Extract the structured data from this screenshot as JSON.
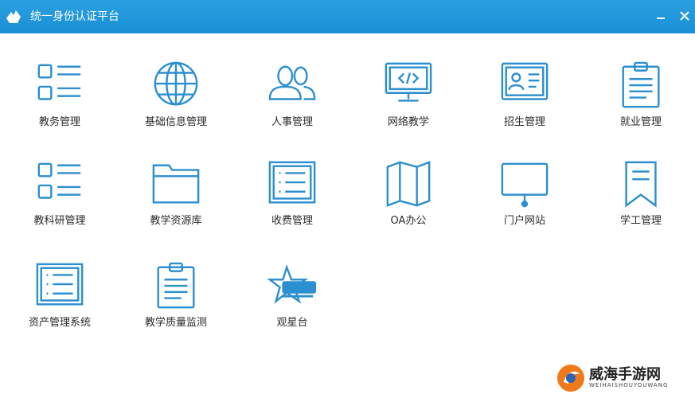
{
  "window": {
    "title": "统一身份认证平台",
    "accent": "#1f95da",
    "icon_color": "#2c8fd0"
  },
  "tiles": [
    {
      "label": "教务管理",
      "icon": "list-icon"
    },
    {
      "label": "基础信息管理",
      "icon": "globe-icon"
    },
    {
      "label": "人事管理",
      "icon": "people-icon"
    },
    {
      "label": "网络教学",
      "icon": "monitor-code-icon"
    },
    {
      "label": "招生管理",
      "icon": "id-card-icon"
    },
    {
      "label": "就业管理",
      "icon": "clipboard-icon"
    },
    {
      "label": "教科研管理",
      "icon": "list-icon"
    },
    {
      "label": "教学资源库",
      "icon": "folder-icon"
    },
    {
      "label": "收费管理",
      "icon": "doc-list-icon"
    },
    {
      "label": "OA办公",
      "icon": "map-icon"
    },
    {
      "label": "门户网站",
      "icon": "display-icon"
    },
    {
      "label": "学工管理",
      "icon": "bookmark-icon"
    },
    {
      "label": "资产管理系统",
      "icon": "doc-list-icon"
    },
    {
      "label": "教学质量监测",
      "icon": "clipboard-icon"
    },
    {
      "label": "观星台",
      "icon": "star-logo-icon"
    }
  ],
  "watermark": {
    "title": "威海手游网",
    "subtitle": "WEIHAISHOUYOUWANG"
  }
}
